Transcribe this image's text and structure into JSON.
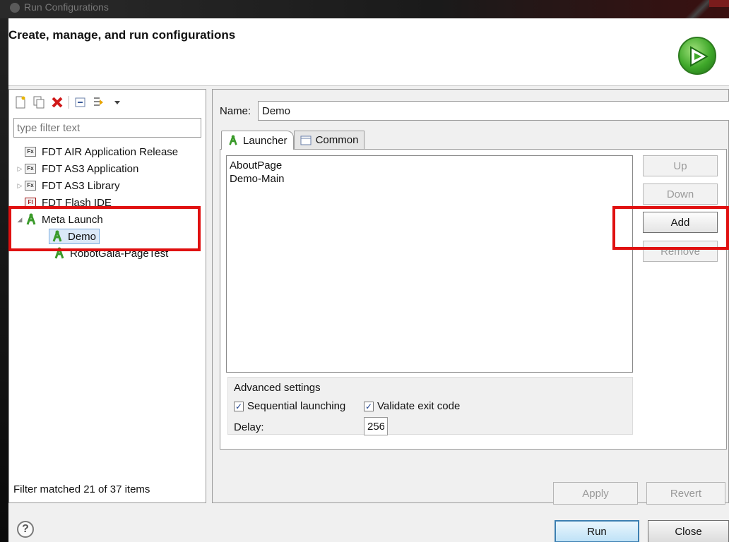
{
  "window": {
    "title": "Run Configurations"
  },
  "header": {
    "title": "Create, manage, and run configurations",
    "icon": "run-icon"
  },
  "toolbar": {
    "icons": [
      "new-config-icon",
      "duplicate-icon",
      "delete-icon",
      "collapse-all-icon",
      "filter-icon",
      "dropdown-arrow-icon"
    ]
  },
  "filter": {
    "placeholder": "type filter text",
    "status": "Filter matched 21 of 37 items"
  },
  "tree": {
    "items": [
      {
        "label": "FDT AIR Application Release",
        "badge": "Fx",
        "expandable": false
      },
      {
        "label": "FDT AS3 Application",
        "badge": "Fx",
        "expandable": true
      },
      {
        "label": "FDT AS3 Library",
        "badge": "Fx",
        "expandable": true
      },
      {
        "label": "FDT Flash IDE",
        "badge": "Fl",
        "expandable": false
      },
      {
        "label": "Meta Launch",
        "expanded": true
      },
      {
        "label": "Demo",
        "selected": true
      },
      {
        "label": "RobotGala-PageTest"
      }
    ]
  },
  "config": {
    "name_label": "Name:",
    "name_value": "Demo",
    "tabs": [
      {
        "label": "Launcher",
        "active": true
      },
      {
        "label": "Common",
        "active": false
      }
    ],
    "launches": [
      "AboutPage",
      "Demo-Main"
    ],
    "buttons": {
      "up": "Up",
      "down": "Down",
      "add": "Add",
      "remove": "Remove"
    },
    "advanced": {
      "title": "Advanced settings",
      "sequential_label": "Sequential launching",
      "sequential_checked": true,
      "validate_label": "Validate exit code",
      "validate_checked": true,
      "delay_label": "Delay:",
      "delay_value": "256"
    },
    "apply_label": "Apply",
    "revert_label": "Revert"
  },
  "footer": {
    "run_label": "Run",
    "close_label": "Close",
    "help_symbol": "?"
  },
  "colors": {
    "highlight": "#e01010",
    "run_icon": "#3fa82a",
    "selection": "#dbe9f8"
  }
}
